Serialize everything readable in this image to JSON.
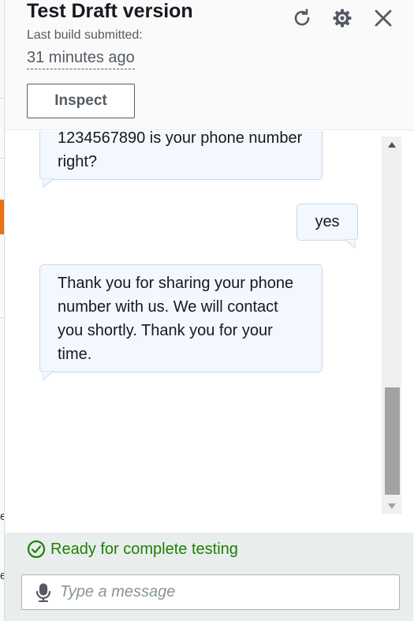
{
  "header": {
    "title": "Test Draft version",
    "subtitle": "Last build submitted:",
    "build_time": "31 minutes ago",
    "inspect_label": "Inspect"
  },
  "toolbar_icons": [
    "refresh-icon",
    "settings-gear-icon",
    "close-icon"
  ],
  "messages": [
    {
      "from": "bot",
      "text": "1234567890 is your phone number right?"
    },
    {
      "from": "user",
      "text": "yes"
    },
    {
      "from": "bot",
      "text": "Thank you for sharing your phone number with us. We will contact you shortly. Thank you for your time."
    }
  ],
  "status": {
    "text": "Ready for complete testing",
    "color": "#1d8102"
  },
  "composer": {
    "placeholder": "Type a message",
    "icon": "microphone-icon"
  },
  "background_page": {
    "letters": [
      "e",
      "e"
    ],
    "accent_color": "#ec7211"
  }
}
